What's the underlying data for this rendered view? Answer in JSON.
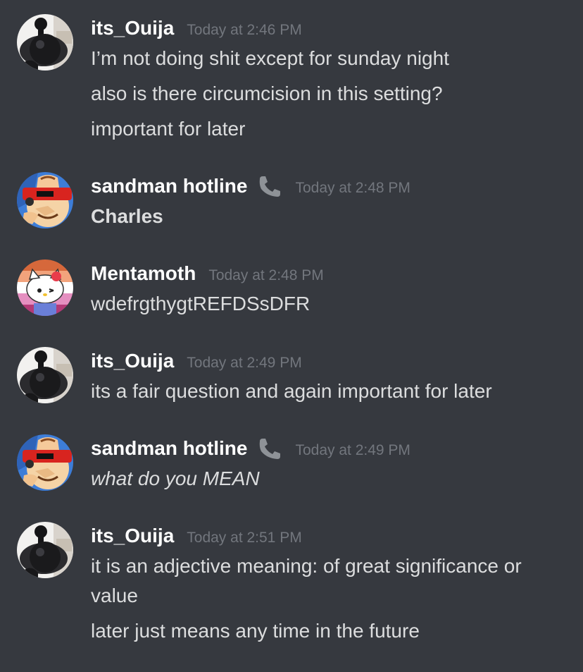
{
  "messages": [
    {
      "username": "its_Ouija",
      "timestamp": "Today at 2:46 PM",
      "lines": [
        "I’m not doing shit except for sunday night",
        "also is there circumcision in this setting?",
        "important for later"
      ]
    },
    {
      "username": "sandman hotline",
      "badge_icon": "phone-icon",
      "timestamp": "Today at 2:48 PM",
      "lines": [
        "Charles"
      ],
      "style": "bold"
    },
    {
      "username": "Mentamoth",
      "timestamp": "Today at 2:48 PM",
      "lines": [
        "wdefrgthygtREFDSsDFR"
      ]
    },
    {
      "username": "its_Ouija",
      "timestamp": "Today at 2:49 PM",
      "lines": [
        "its a fair question and again important for later"
      ]
    },
    {
      "username": "sandman hotline",
      "badge_icon": "phone-icon",
      "timestamp": "Today at 2:49 PM",
      "lines": [
        "what do you MEAN"
      ],
      "style": "italic"
    },
    {
      "username": "its_Ouija",
      "timestamp": "Today at 2:51 PM",
      "lines": [
        "it is an adjective meaning: of great significance or value",
        "later just means any time in the future"
      ]
    }
  ],
  "colors": {
    "background": "#36393f",
    "username": "#ffffff",
    "message_text": "#dcddde",
    "timestamp": "#72767d"
  }
}
